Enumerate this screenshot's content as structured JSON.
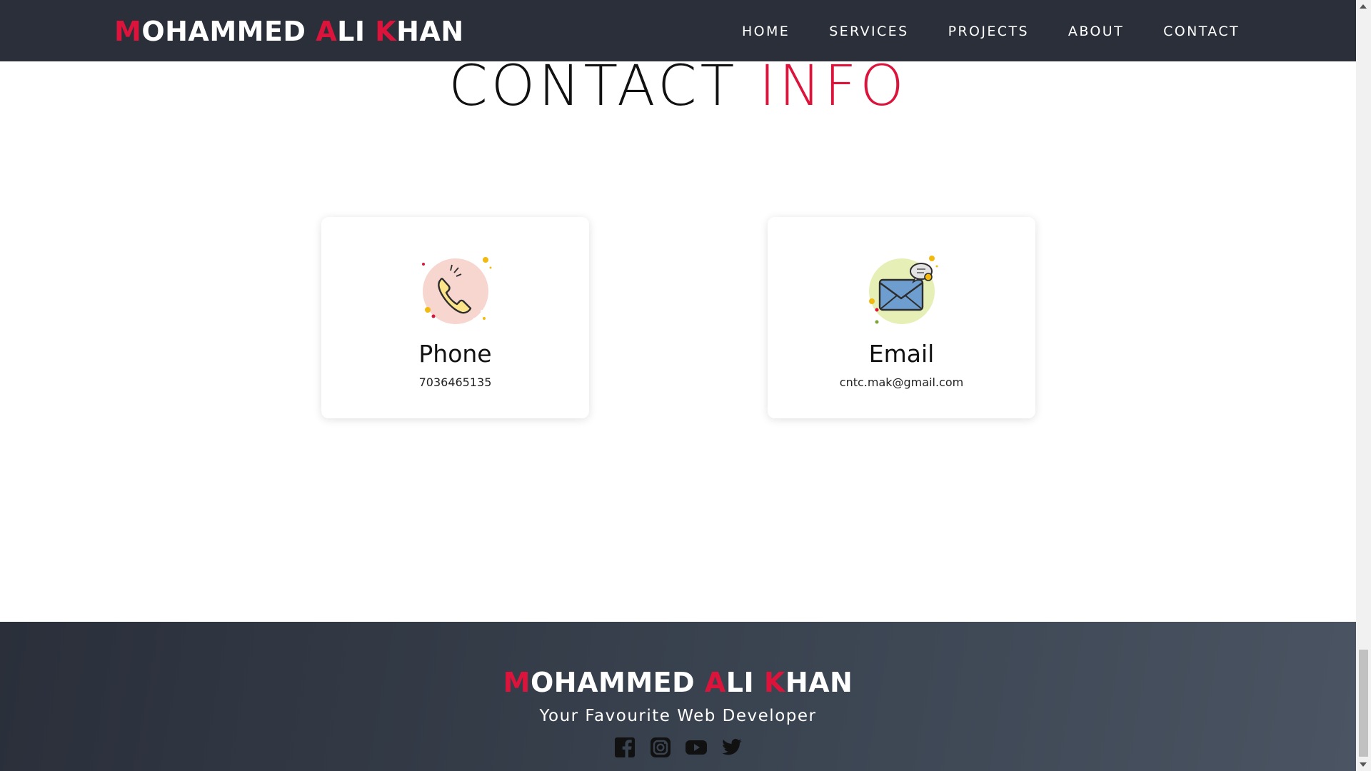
{
  "brand": {
    "letters": [
      "M",
      "OHAMMED ",
      "A",
      "LI ",
      "K",
      "HAN"
    ]
  },
  "nav": {
    "items": [
      {
        "label": "HOME"
      },
      {
        "label": "SERVICES"
      },
      {
        "label": "PROJECTS"
      },
      {
        "label": "ABOUT"
      },
      {
        "label": "CONTACT"
      }
    ]
  },
  "section": {
    "title_main": "CONTACT ",
    "title_accent": "INFO"
  },
  "cards": [
    {
      "title": "Phone",
      "value": "7036465135",
      "icon": "phone-icon"
    },
    {
      "title": "Email",
      "value": "cntc.mak@gmail.com",
      "icon": "email-icon"
    }
  ],
  "footer": {
    "brand_letters": [
      "M",
      "OHAMMED ",
      "A",
      "LI ",
      "K",
      "HAN"
    ],
    "tagline": "Your Favourite Web Developer",
    "socials": [
      "facebook-icon",
      "instagram-icon",
      "youtube-icon",
      "twitter-icon"
    ]
  },
  "colors": {
    "accent": "#dc143c",
    "nav_bg": "#2a2f3a",
    "footer_bg": "#3a4350"
  }
}
